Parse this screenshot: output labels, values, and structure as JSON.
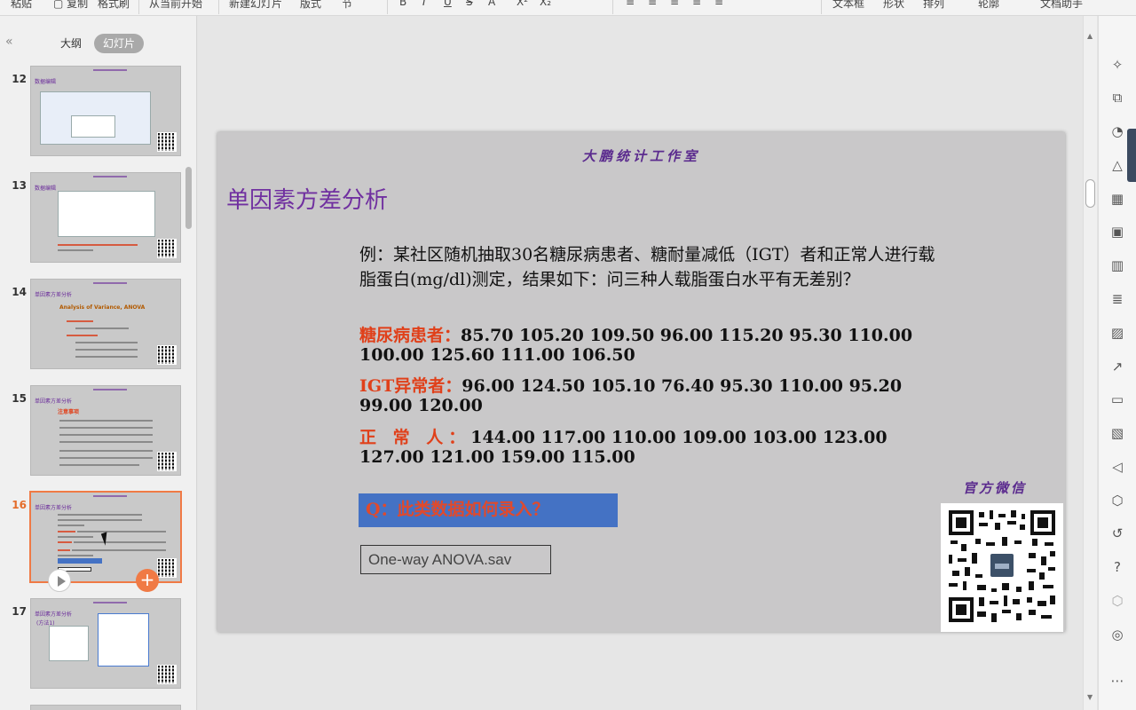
{
  "toolbar": {
    "items": [
      "粘贴",
      "复制",
      "格式刷",
      "从当前开始",
      "新建幻灯片",
      "版式",
      "节",
      "B",
      "I",
      "U",
      "S",
      "A",
      "X²",
      "X₂",
      "文本框",
      "形状",
      "排列",
      "轮廓",
      "文档助手"
    ]
  },
  "left_pane": {
    "tab_outline": "大纲",
    "tab_slides": "幻灯片",
    "thumbnails": [
      {
        "num": "12",
        "title": "数据编辑"
      },
      {
        "num": "13",
        "title": "数据编辑"
      },
      {
        "num": "14",
        "title": "单因素方差分析"
      },
      {
        "num": "15",
        "title": "单因素方差分析"
      },
      {
        "num": "16",
        "title": "单因素方差分析"
      },
      {
        "num": "17",
        "title": "单因素方差分析"
      }
    ],
    "thumb14_heading": "Analysis of Variance, ANOVA",
    "thumb15_heading": "注意事项",
    "thumb17_sub": "(方法1)"
  },
  "slide": {
    "header": "大鹏统计工作室",
    "title": "单因素方差分析",
    "example": "例：某社区随机抽取30名糖尿病患者、糖耐量减低（IGT）者和正常人进行载脂蛋白(mg/dl)测定，结果如下：问三种人载脂蛋白水平有无差别？",
    "groups": [
      {
        "label": "糖尿病患者：",
        "values": "85.70 105.20 109.50 96.00 115.20 95.30 110.00 100.00 125.60 111.00 106.50"
      },
      {
        "label": "IGT异常者：",
        "values": "96.00 124.50 105.10 76.40 95.30 110.00 95.20 99.00 120.00"
      },
      {
        "label": "正 常 人：",
        "values": "144.00 117.00 110.00 109.00 103.00 123.00 127.00 121.00 159.00 115.00"
      }
    ],
    "question": "Q：此类数据如何录入？",
    "file_name": "One-way ANOVA.sav",
    "wechat_label": "官方微信"
  },
  "colors": {
    "accent_orange": "#f07a45",
    "title_purple": "#7030a0",
    "label_red": "#e0401a",
    "question_blue": "#4472c4"
  },
  "right_bar_icons": [
    "star-icon",
    "shapes-icon",
    "pie-icon",
    "triangle-icon",
    "table-icon",
    "grid-icon",
    "bar-chart-icon",
    "sliders-icon",
    "image-edit-icon",
    "share-icon",
    "archive-icon",
    "picture-icon",
    "speaker-icon",
    "badge-icon",
    "history-icon",
    "help-icon",
    "cube-icon",
    "location-icon",
    "more-icon"
  ]
}
